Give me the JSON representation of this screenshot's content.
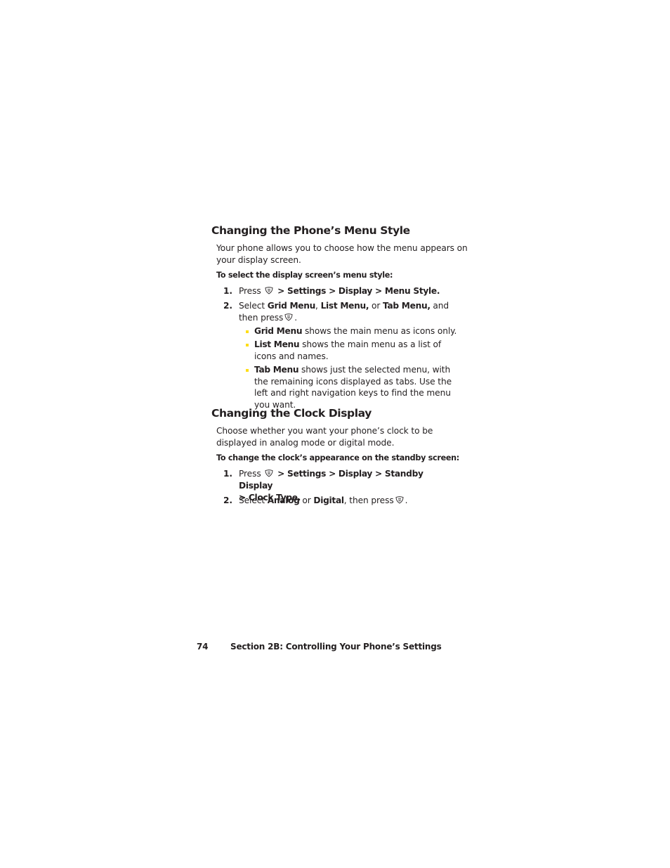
{
  "section1": {
    "heading": "Changing the Phone’s Menu Style",
    "intro": "Your phone allows you to choose how the menu appears on your display screen.",
    "lead": "To select the display screen’s menu style:",
    "steps": [
      {
        "num": "1.",
        "pre": "Press",
        "path": "> Settings > Display > Menu Style."
      },
      {
        "num": "2.",
        "t1": "Select ",
        "b1": "Grid Menu",
        "t2": ", ",
        "b2": "List Menu,",
        "t3": " or ",
        "b3": "Tab Menu,",
        "t4": " and then press",
        "t5": "."
      }
    ],
    "bullets": [
      {
        "term": "Grid Menu",
        "text": " shows the main menu as icons only."
      },
      {
        "term": "List Menu",
        "text": " shows the main menu as a list of icons and names."
      },
      {
        "term": "Tab Menu",
        "text": " shows just the selected menu, with the remaining icons displayed as tabs. Use the left and right navigation keys to find the menu you want."
      }
    ]
  },
  "section2": {
    "heading": "Changing the Clock Display",
    "intro": "Choose whether you want your phone’s clock to be displayed in analog mode or digital mode.",
    "lead": "To change the clock’s appearance on the standby screen:",
    "steps": [
      {
        "num": "1.",
        "pre": "Press",
        "path1": "> Settings > Display > Standby Display",
        "path2": "> Clock Type."
      },
      {
        "num": "2.",
        "t1": "Select ",
        "b1": "Analog",
        "t2": " or ",
        "b2": "Digital",
        "t3": ", then press",
        "t4": "."
      }
    ]
  },
  "footer": {
    "page_number": "74",
    "section_title": "Section 2B: Controlling Your Phone’s Settings"
  },
  "colors": {
    "bullet": "#ffde17",
    "text": "#231f20"
  }
}
